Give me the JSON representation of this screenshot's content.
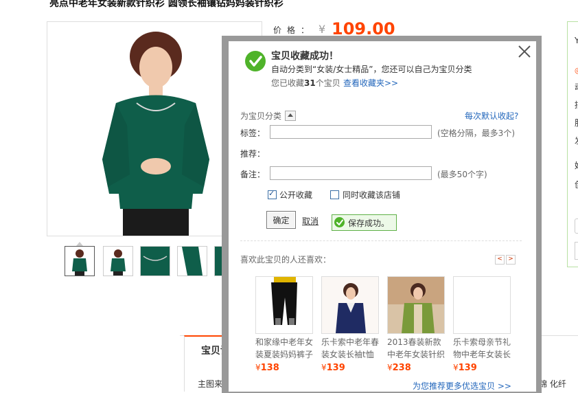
{
  "page": {
    "title": "亮点中老年女装新款针织衫 圆领长袖镶钻妈妈装针织衫",
    "price_label": "价格：",
    "price_currency": "¥",
    "price_value": "109.00",
    "detail_tab": "宝贝详",
    "bottom_left_text": "主图来源",
    "bottom_right_text": "锦 化纤",
    "side_items": [
      "Y",
      "◎",
      "动",
      "描",
      "服",
      "发",
      "好",
      "创"
    ]
  },
  "modal": {
    "success_title": "宝贝收藏成功！",
    "auto_category": "自动分类到“女装/女士精品”，您还可以自己为宝贝分类",
    "collected_prefix": "您已收藏",
    "collected_count": "31",
    "collected_suffix": "个宝贝",
    "view_favorites": "查看收藏夹>>",
    "classify_label": "为宝贝分类",
    "default_collapse_link": "每次默认收起?",
    "tag_label": "标签：",
    "tag_value": "",
    "tag_hint": "(空格分隔，最多3个)",
    "recommend_label": "推荐：",
    "note_label": "备注：",
    "note_value": "",
    "note_hint": "(最多50个字)",
    "public_label": "公开收藏",
    "public_checked": true,
    "store_label": "同时收藏该店铺",
    "store_checked": false,
    "confirm_button": "确定",
    "cancel_link": "取消",
    "saved_message": "保存成功。",
    "also_like_label": "喜欢此宝贝的人还喜欢：",
    "prev_page": "<",
    "next_page": ">",
    "recommendations": [
      {
        "title": "和家缘中老年女装夏装妈妈裤子",
        "currency": "¥",
        "price": "138"
      },
      {
        "title": "乐卡索中老年春装女装长袖t恤",
        "currency": "¥",
        "price": "139"
      },
      {
        "title": "2013春装新款中老年女装针织衫",
        "currency": "¥",
        "price": "238"
      },
      {
        "title": "乐卡索母亲节礼物中老年女装长",
        "currency": "¥",
        "price": "139"
      }
    ],
    "more_link": "为您推荐更多优选宝贝 >>"
  },
  "colors": {
    "price": "#ff4400",
    "accent_green": "#4fb32a",
    "link_blue": "#2266bb"
  }
}
